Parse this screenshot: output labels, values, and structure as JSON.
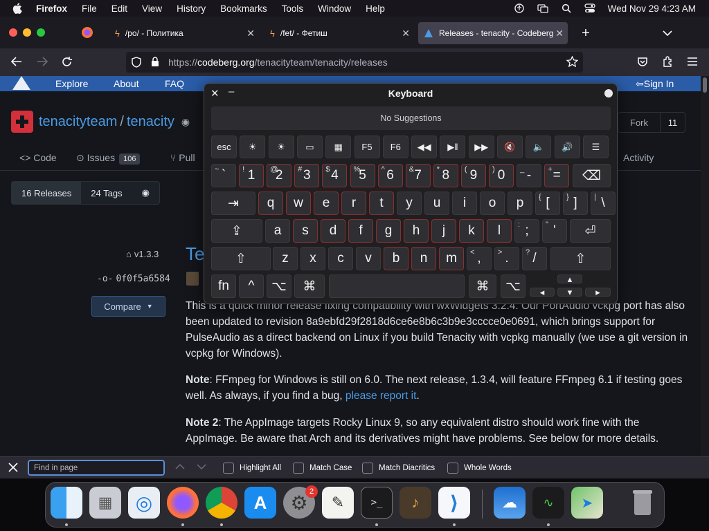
{
  "menubar": {
    "items": [
      "Firefox",
      "File",
      "Edit",
      "View",
      "History",
      "Bookmarks",
      "Tools",
      "Window",
      "Help"
    ],
    "clock": "Wed Nov 29  4:23 AM"
  },
  "tabs": [
    {
      "title": "/po/ - Политика"
    },
    {
      "title": "/fet/ - Фетиш"
    },
    {
      "title": "Releases - tenacity - Codeberg"
    }
  ],
  "nav": {
    "url_prefix": "https://",
    "url_host": "codeberg.org",
    "url_path": "/tenacityteam/tenacity/releases"
  },
  "site": {
    "nav": [
      "Explore",
      "About",
      "FAQ"
    ],
    "sign_in": "Sign In",
    "owner": "tenacityteam",
    "slash": "/",
    "repo": "tenacity",
    "fork_label": "Fork",
    "fork_count": "11",
    "repo_tabs": {
      "code": "Code",
      "issues": "Issues",
      "issues_count": "106",
      "pull": "Pull",
      "activity": "Activity"
    },
    "releases_tab": "16 Releases",
    "tags_tab": "24 Tags",
    "tag": "v1.3.3",
    "commit": "0f0f5a6584",
    "compare": "Compare",
    "release_title_partial": "Te",
    "para1": "This is a quick minor release fixing compatibility with wxWidgets 3.2.4. Our PortAudio vckpg port has also been updated to revision 8a9ebfd29f2818d6ce6e8b6c3b9e3cccce0e0691, which brings support for PulseAudio as a direct backend on Linux if you build Tenacity with vcpkg manually (we use a git version in vcpkg for Windows).",
    "note_label": "Note",
    "note_text": ": FFmpeg for Windows is still on 6.0. The next release, 1.3.4, will feature FFmpeg 6.1 if testing goes well. As always, if you find a bug, ",
    "note_link": "please report it",
    "note_end": ".",
    "note2_label": "Note 2",
    "note2_text": ": The AppImage targets Rocky Linux 9, so any equivalent distro should work fine with the AppImage. Be aware that Arch and its derivatives might have problems. See below for more details."
  },
  "keyboard": {
    "title": "Keyboard",
    "suggestions": "No Suggestions",
    "fn_row": [
      "esc",
      "☀",
      "☀",
      "▭",
      "▦",
      "F5",
      "F6",
      "◀◀",
      "▶‖",
      "▶▶",
      "🔇",
      "🔈",
      "🔊",
      "☰"
    ],
    "row1": [
      [
        "~",
        "`"
      ],
      [
        "!",
        "1"
      ],
      [
        "@",
        "2"
      ],
      [
        "#",
        "3"
      ],
      [
        "$",
        "4"
      ],
      [
        "%",
        "5"
      ],
      [
        "^",
        "6"
      ],
      [
        "&",
        "7"
      ],
      [
        "*",
        "8"
      ],
      [
        "(",
        "9"
      ],
      [
        ")",
        "0"
      ],
      [
        "_",
        "-"
      ],
      [
        "+",
        "="
      ]
    ],
    "row2": [
      "q",
      "w",
      "e",
      "r",
      "t",
      "y",
      "u",
      "i",
      "o",
      "p",
      [
        "{",
        "["
      ],
      [
        "}",
        "]"
      ],
      [
        "|",
        "\\"
      ]
    ],
    "row3": [
      "a",
      "s",
      "d",
      "f",
      "g",
      "h",
      "j",
      "k",
      "l",
      [
        ":",
        ";"
      ],
      [
        "\"",
        "'"
      ]
    ],
    "row4": [
      "z",
      "x",
      "c",
      "v",
      "b",
      "n",
      "m",
      [
        "<",
        ","
      ],
      [
        ">",
        "."
      ],
      [
        "?",
        "/"
      ]
    ],
    "mods": {
      "fn": "fn",
      "ctrl": "^",
      "opt": "⌥",
      "cmd": "⌘"
    }
  },
  "findbar": {
    "placeholder": "Find in page",
    "options": [
      "Highlight All",
      "Match Case",
      "Match Diacritics",
      "Whole Words"
    ]
  },
  "dock": {
    "badge": "2",
    "apps": [
      "finder-icon",
      "launchpad-icon",
      "safari-icon",
      "firefox-icon",
      "chrome-icon",
      "app-store-icon",
      "system-settings-icon",
      "textedit-icon",
      "terminal-icon",
      "garageband-icon",
      "vscode-icon",
      "weather-icon",
      "activity-monitor-icon",
      "maps-icon",
      "trash-icon"
    ]
  }
}
